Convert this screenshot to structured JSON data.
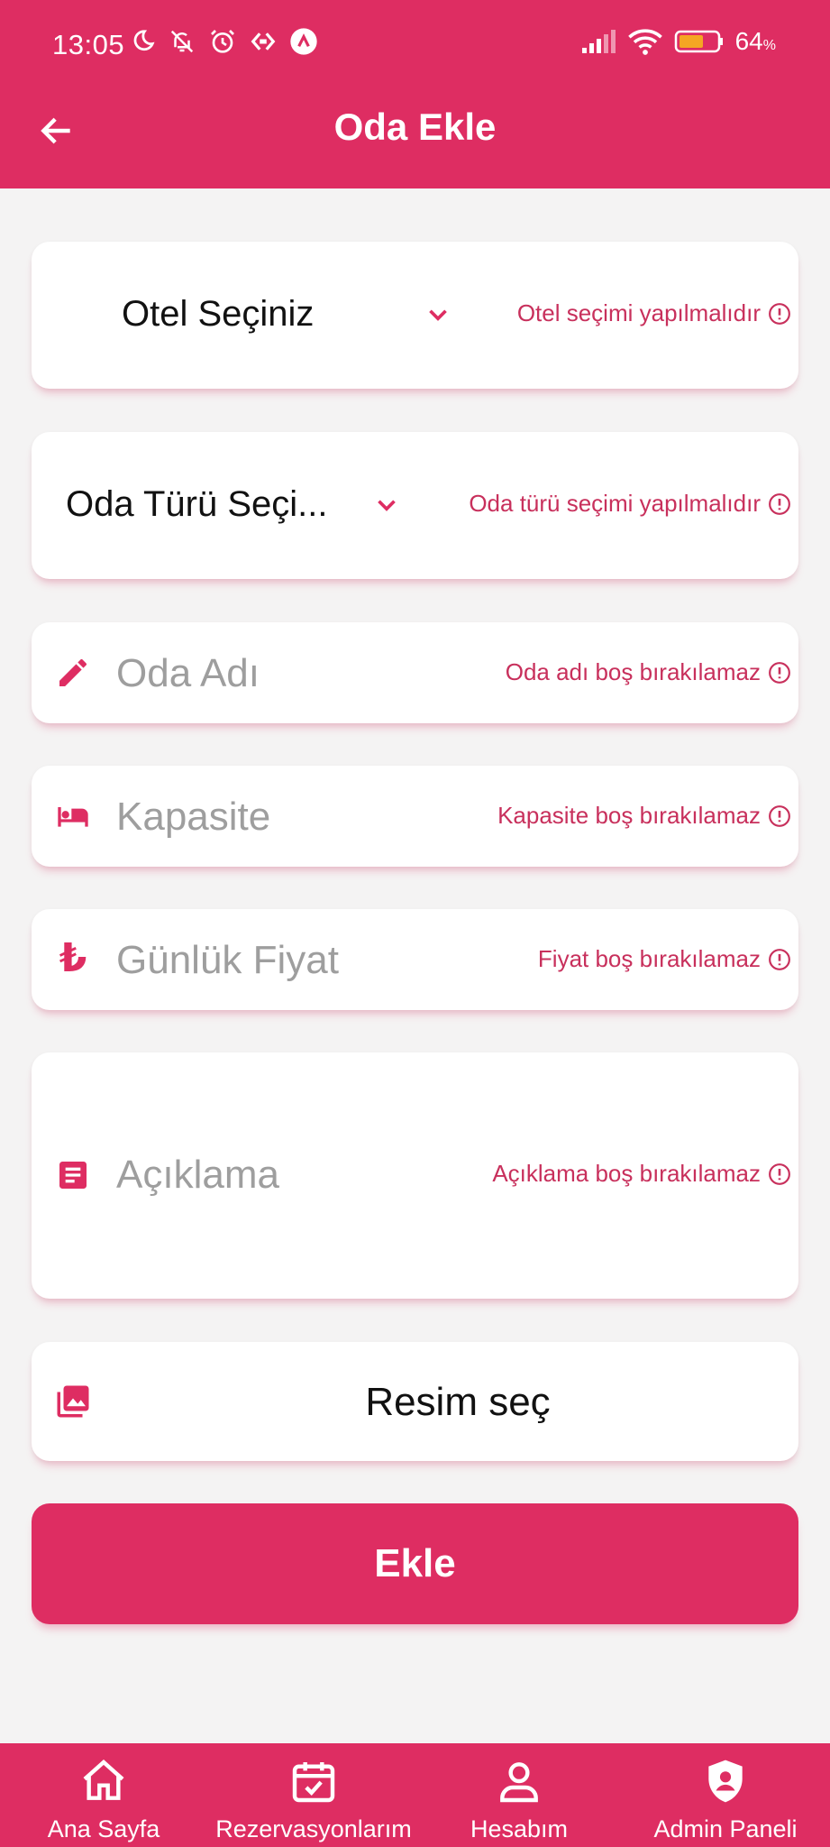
{
  "status_bar": {
    "time": "13:05",
    "battery": "64",
    "battery_unit": "%"
  },
  "header": {
    "title": "Oda Ekle"
  },
  "form": {
    "hotel_select": {
      "value": "Otel Seçiniz",
      "error": "Otel seçimi yapılmalıdır"
    },
    "room_type_select": {
      "value": "Oda Türü Seçi...",
      "error": "Oda türü seçimi yapılmalıdır"
    },
    "room_name": {
      "placeholder": "Oda Adı",
      "error": "Oda adı boş bırakılamaz"
    },
    "capacity": {
      "placeholder": "Kapasite",
      "error": "Kapasite boş bırakılamaz"
    },
    "price": {
      "currency_symbol": "₺",
      "placeholder": "Günlük Fiyat",
      "error": "Fiyat boş bırakılamaz"
    },
    "description": {
      "placeholder": "Açıklama",
      "error": "Açıklama boş bırakılamaz"
    },
    "image_picker": {
      "label": "Resim seç"
    },
    "submit_label": "Ekle"
  },
  "bottom_nav": [
    {
      "label": "Ana Sayfa",
      "icon": "home-icon"
    },
    {
      "label": "Rezervasyonlarım",
      "icon": "calendar-check-icon"
    },
    {
      "label": "Hesabım",
      "icon": "person-icon"
    },
    {
      "label": "Admin Paneli",
      "icon": "admin-shield-icon"
    }
  ],
  "colors": {
    "primary": "#de2d62",
    "error_text": "#c8305c",
    "background": "#f4f3f3",
    "placeholder": "#9e9e9e"
  }
}
